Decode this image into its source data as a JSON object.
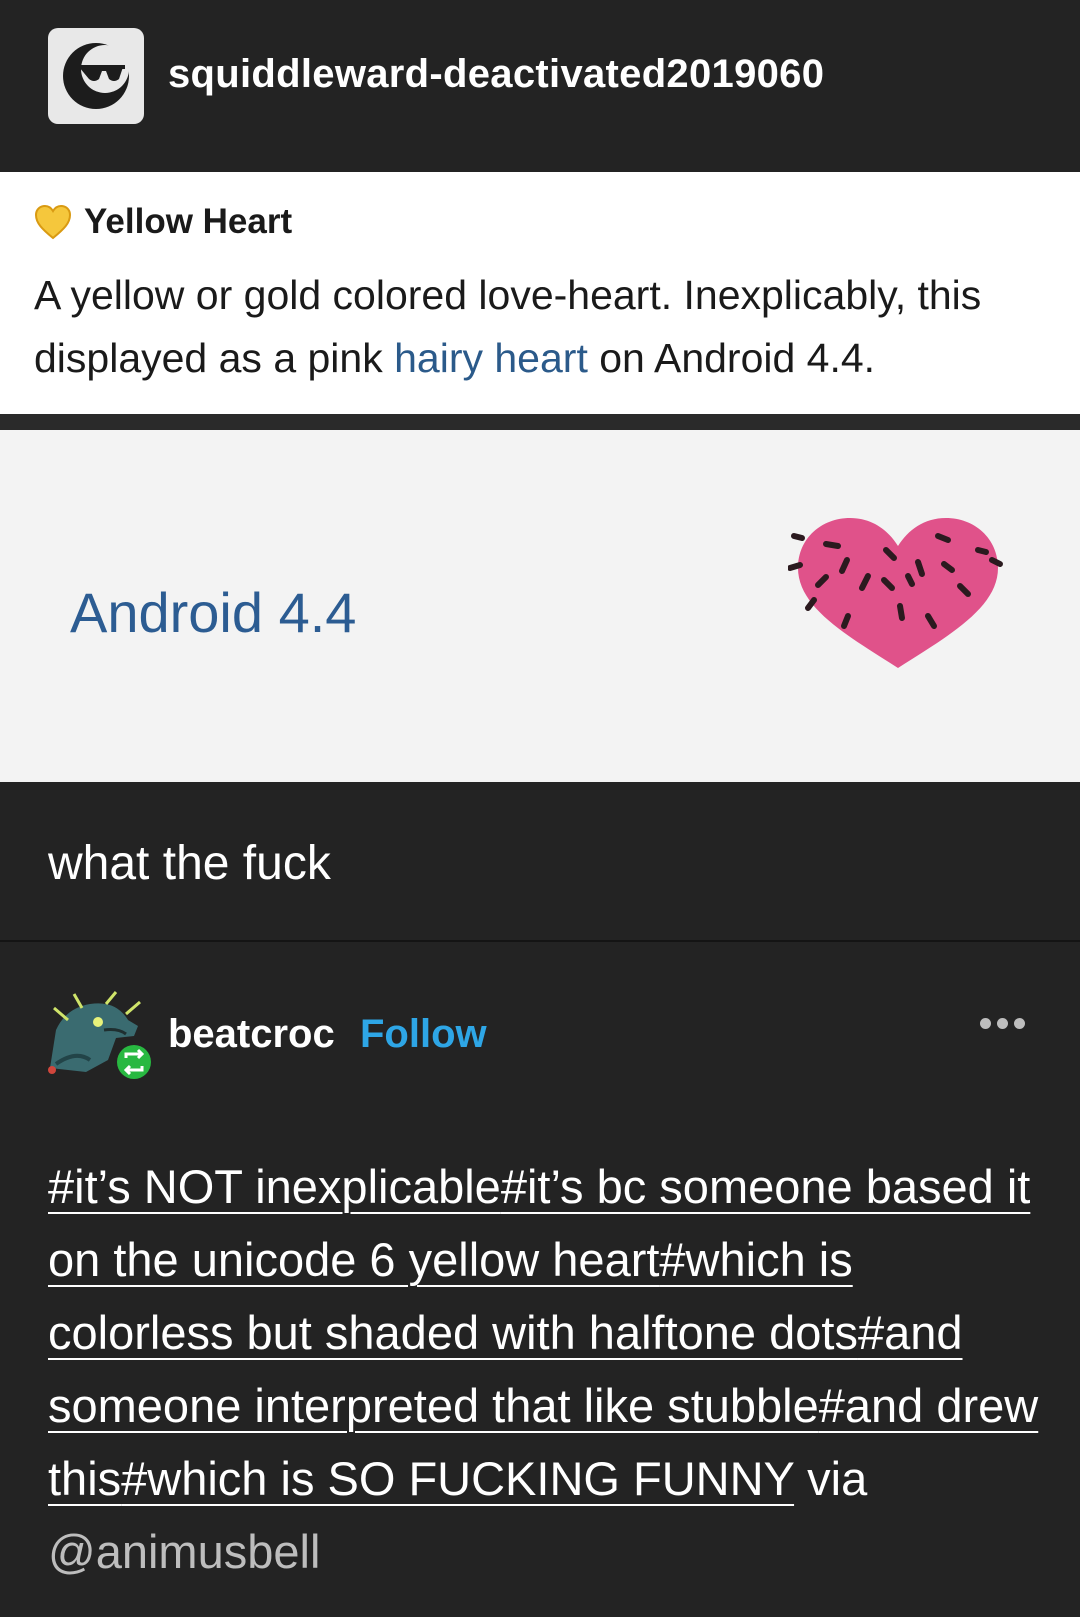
{
  "post": {
    "author": "squiddleward-deactivated2019060",
    "avatar_icon": "sunglasses-moon-icon",
    "emoji_card": {
      "icon": "yellow-heart-icon",
      "name": "Yellow Heart",
      "description_pre": "A yellow or gold colored love-heart. Inexplicably, this displayed as a pink ",
      "description_link": "hairy heart",
      "description_post": " on Android 4.4."
    },
    "platform_card": {
      "label": "Android 4.4",
      "heart_icon": "pink-hairy-heart-icon"
    },
    "body": "what the fuck"
  },
  "reblog": {
    "author": "beatcroc",
    "follow_label": "Follow",
    "avatar_icon": "dragon-avatar-icon",
    "reblog_badge_icon": "reblog-icon",
    "more_icon": "more-options-icon",
    "tags": [
      "#it’s NOT inexplicable",
      "#it’s bc someone based it on the unicode 6 yellow heart",
      "#which is colorless but shaded with halftone dots",
      "#and someone interpreted that like stubble",
      "#and drew this",
      "#which is SO FUCKING FUNNY"
    ],
    "via_label": "via",
    "via_user": "@animusbell"
  },
  "colors": {
    "background": "#232323",
    "link_blue": "#2ea6e6",
    "android_blue": "#2c5c92",
    "hairy_heart_pink": "#e0528a",
    "yellow_heart": "#f5c73c"
  }
}
